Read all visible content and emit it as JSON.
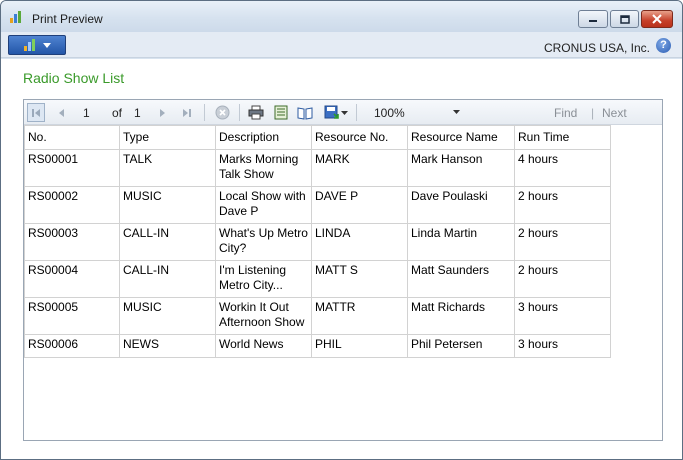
{
  "window": {
    "title": "Print Preview"
  },
  "nav": {
    "company": "CRONUS USA, Inc.",
    "help": "?"
  },
  "page": {
    "title": "Radio Show List"
  },
  "toolbar": {
    "page_current": "1",
    "page_of_label": "of",
    "page_total": "1",
    "zoom_value": "100%",
    "find_label": "Find",
    "separator": "|",
    "next_label": "Next"
  },
  "table": {
    "headers": [
      "No.",
      "Type",
      "Description",
      "Resource No.",
      "Resource Name",
      "Run Time"
    ],
    "rows": [
      {
        "no": "RS00001",
        "type": "TALK",
        "description": "Marks Morning Talk Show",
        "resource_no": "MARK",
        "resource_name": "Mark Hanson",
        "run_time": "4 hours"
      },
      {
        "no": "RS00002",
        "type": "MUSIC",
        "description": "Local Show with Dave P",
        "resource_no": "DAVE P",
        "resource_name": "Dave Poulaski",
        "run_time": "2 hours"
      },
      {
        "no": "RS00003",
        "type": "CALL-IN",
        "description": "What's Up Metro City?",
        "resource_no": "LINDA",
        "resource_name": "Linda Martin",
        "run_time": "2 hours"
      },
      {
        "no": "RS00004",
        "type": "CALL-IN",
        "description": "I'm Listening Metro City...",
        "resource_no": "MATT S",
        "resource_name": "Matt Saunders",
        "run_time": "2 hours"
      },
      {
        "no": "RS00005",
        "type": "MUSIC",
        "description": "Workin It Out Afternoon Show",
        "resource_no": "MATTR",
        "resource_name": "Matt Richards",
        "run_time": "3 hours"
      },
      {
        "no": "RS00006",
        "type": "NEWS",
        "description": "World News",
        "resource_no": "PHIL",
        "resource_name": "Phil Petersen",
        "run_time": "3 hours"
      }
    ]
  },
  "colors": {
    "title_green": "#3a9a2a",
    "menu_blue": "#2356a8",
    "close_red": "#c6402a"
  }
}
